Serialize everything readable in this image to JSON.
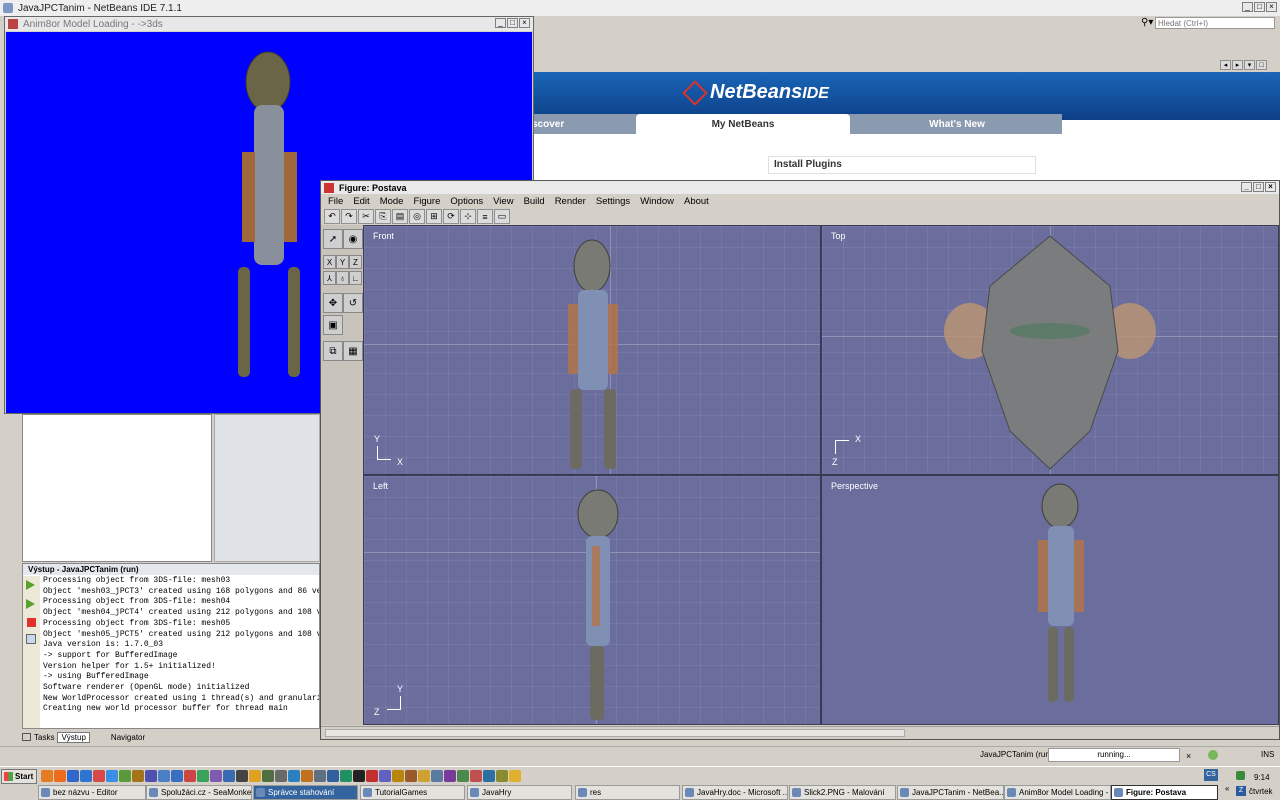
{
  "netbeans": {
    "title": "JavaJPCTanim - NetBeans IDE 7.1.1",
    "search_placeholder": "Hledat (Ctrl+I)",
    "logo_text": "NetBeans",
    "logo_suffix": "IDE",
    "tabs": [
      "scover",
      "My NetBeans",
      "What's New"
    ],
    "install_plugins": "Install Plugins"
  },
  "anim_window": {
    "title": "Anim8or Model Loading - ->3ds",
    "bg_color": "#0000ff"
  },
  "output_panel": {
    "title": "Výstup - JavaJPCTanim (run)",
    "lines": [
      "Processing object from 3DS-file: mesh03",
      "Object 'mesh03_jPCT3' created using 168 polygons and 86 ver",
      "Processing object from 3DS-file: mesh04",
      "Object 'mesh04_jPCT4' created using 212 polygons and 108 ve",
      "Processing object from 3DS-file: mesh05",
      "Object 'mesh05_jPCT5' created using 212 polygons and 108 ve",
      "Java version is: 1.7.0_03",
      "-> support for BufferedImage",
      "Version helper for 1.5+ initialized!",
      "-> using BufferedImage",
      "Software renderer (OpenGL mode) initialized",
      "New WorldProcessor created using 1 thread(s) and granularit",
      "Creating new world processor buffer for thread main"
    ],
    "bottom_tabs": [
      "Tasks",
      "Výstup",
      "Navigator"
    ]
  },
  "figure_window": {
    "title": "Figure: Postava",
    "menu": [
      "File",
      "Edit",
      "Mode",
      "Figure",
      "Options",
      "View",
      "Build",
      "Render",
      "Settings",
      "Window",
      "About"
    ],
    "axis_buttons": [
      "X",
      "Y",
      "Z"
    ],
    "viewports": {
      "front": {
        "label": "Front",
        "axis_v": "Y",
        "axis_h": "X"
      },
      "top": {
        "label": "Top",
        "axis_v": "Z",
        "axis_h": "X"
      },
      "left": {
        "label": "Left",
        "axis_v": "Y",
        "axis_h": "Z"
      },
      "perspective": {
        "label": "Perspective"
      }
    },
    "viewport_color": "#6b6d9d"
  },
  "status_bar": {
    "project": "JavaJPCTanim (run)",
    "progress_text": "running...",
    "mode": "INS"
  },
  "taskbar": {
    "start_label": "Start",
    "tasks": [
      "bez názvu - Editor",
      "Spolužáci.cz - SeaMonkey",
      "Správce stahování",
      "TutorialGames",
      "JavaHry",
      "res",
      "JavaHry.doc - Microsoft ...",
      "Slick2.PNG - Malování",
      "JavaJPCTanim - NetBea...",
      "Anim8or Model Loading - ...",
      "Figure: Postava"
    ],
    "language": "CS",
    "clock": "9:14",
    "day": "čtvrtek"
  }
}
